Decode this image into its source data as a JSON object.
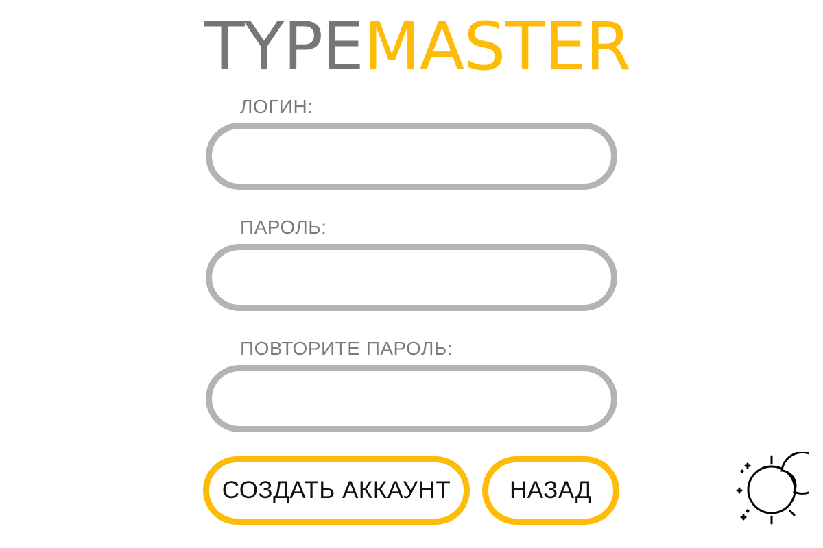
{
  "logo": {
    "part1": "TYPE",
    "part2": "MASTER",
    "colors": {
      "part1": "#767676",
      "part2": "#fdbb0a"
    }
  },
  "form": {
    "login": {
      "label": "ЛОГИН:",
      "value": ""
    },
    "password": {
      "label": "ПАРОЛЬ:",
      "value": ""
    },
    "repeat_password": {
      "label": "ПОВТОРИТЕ ПАРОЛЬ:",
      "value": ""
    }
  },
  "buttons": {
    "create_account": "СОЗДАТЬ АККАУНТ",
    "back": "НАЗАД"
  },
  "theme_toggle": {
    "icon": "moon-sun-icon"
  },
  "colors": {
    "accent": "#fdbb0a",
    "input_border": "#b3b3b3",
    "label_text": "#7a7a7a",
    "button_text": "#111111"
  }
}
